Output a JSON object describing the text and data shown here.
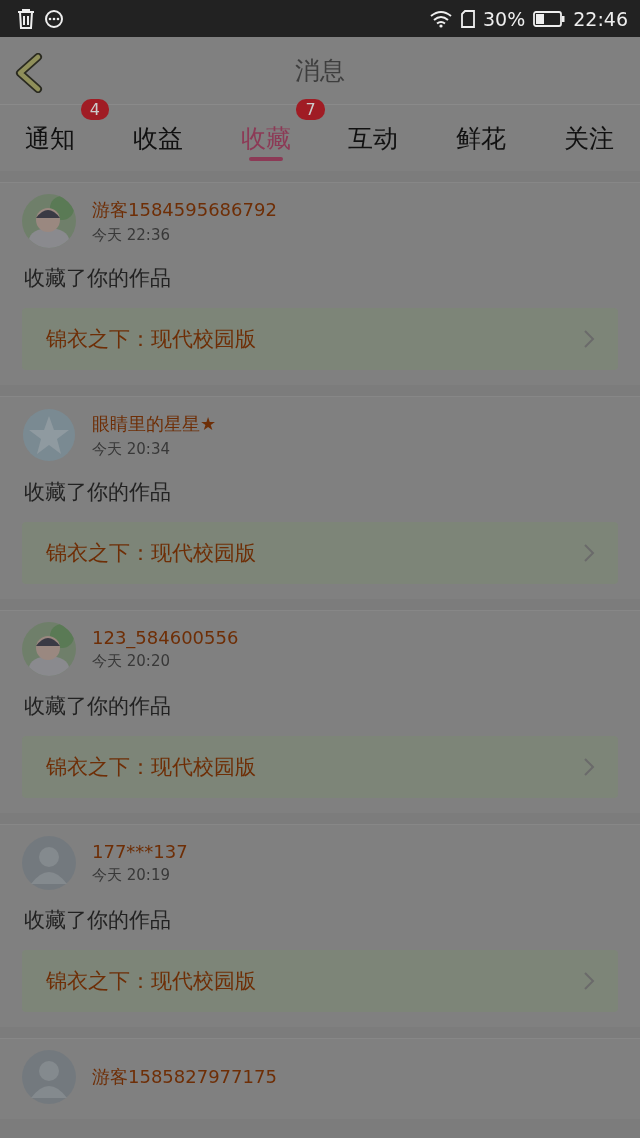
{
  "status_bar": {
    "battery": "30%",
    "time": "22:46"
  },
  "header": {
    "title": "消息"
  },
  "tabs": [
    {
      "label": "通知",
      "badge": "4",
      "selected": false
    },
    {
      "label": "收益",
      "selected": false
    },
    {
      "label": "收藏",
      "badge": "7",
      "selected": true
    },
    {
      "label": "互动",
      "selected": false
    },
    {
      "label": "鲜花",
      "selected": false
    },
    {
      "label": "关注",
      "selected": false
    }
  ],
  "messages": [
    {
      "name": "游客1584595686792",
      "time": "今天 22:36",
      "action": "收藏了你的作品",
      "work": "锦衣之下：现代校园版"
    },
    {
      "avatar": {
        "kind": "star"
      },
      "name": "眼睛里的星星★",
      "time": "今天 20:34",
      "action": "收藏了你的作品",
      "work": "锦衣之下：现代校园版"
    },
    {
      "name": "123_584600556",
      "time": "今天 20:20",
      "action": "收藏了你的作品",
      "work": "锦衣之下：现代校园版"
    },
    {
      "avatar": {
        "kind": "default"
      },
      "name": "177***137",
      "time": "今天 20:19",
      "action": "收藏了你的作品",
      "work": "锦衣之下：现代校园版"
    },
    {
      "avatar": {
        "kind": "default"
      },
      "name": "游客1585827977175"
    }
  ]
}
